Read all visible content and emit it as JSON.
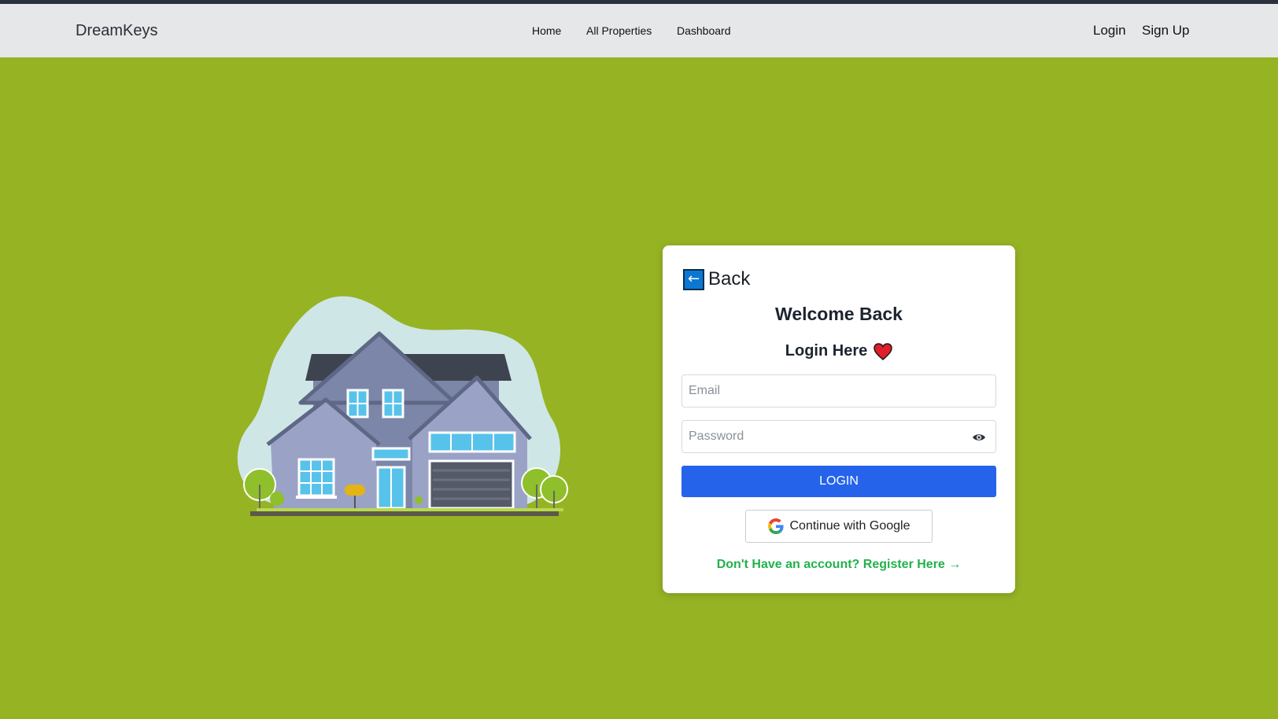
{
  "navbar": {
    "brand": "DreamKeys",
    "links": [
      {
        "label": "Home"
      },
      {
        "label": "All Properties"
      },
      {
        "label": "Dashboard"
      }
    ],
    "auth": {
      "login_label": "Login",
      "signup_label": "Sign Up"
    }
  },
  "login_card": {
    "back_label": "Back",
    "back_icon": "left-arrow-icon",
    "heading": "Welcome Back",
    "subheading": "Login Here",
    "subheading_icon": "heart-icon",
    "email": {
      "placeholder": "Email",
      "value": ""
    },
    "password": {
      "placeholder": "Password",
      "value": "",
      "toggle_icon": "eye-icon"
    },
    "submit_label": "LOGIN",
    "google_label": "Continue with Google",
    "register_label": "Don't Have an account? Register Here →"
  },
  "colors": {
    "page_background": "#96b324",
    "navbar_background": "#e5e7e8",
    "primary_button": "#2563eb",
    "register_link": "#22b14c",
    "heart": "#e01e2a"
  }
}
